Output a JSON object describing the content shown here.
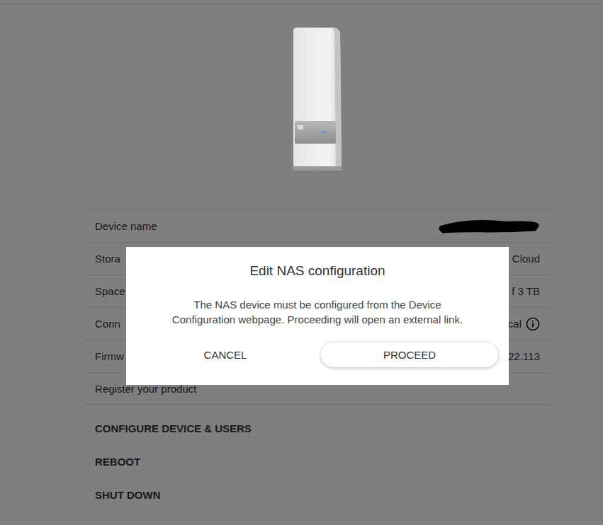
{
  "rows": [
    {
      "label": "Device name",
      "value": "",
      "kind": "redacted"
    },
    {
      "label": "Stora",
      "value": "Cloud",
      "kind": "text"
    },
    {
      "label": "Space",
      "value": "f 3 TB",
      "kind": "text"
    },
    {
      "label": "Conn",
      "value": "cal",
      "kind": "info"
    },
    {
      "label": "Firmw",
      "value": "22.113",
      "kind": "text"
    },
    {
      "label": "Register your product",
      "value": "",
      "kind": "link"
    }
  ],
  "actions": [
    "CONFIGURE DEVICE & USERS",
    "REBOOT",
    "SHUT DOWN"
  ],
  "dialog": {
    "title": "Edit NAS configuration",
    "body_lines": [
      "The NAS device must be configured from the Device",
      "Configuration webpage. Proceeding will open an external link."
    ],
    "buttons": [
      {
        "label": "CANCEL",
        "primary": false
      },
      {
        "label": "PROCEED",
        "primary": true
      }
    ]
  }
}
